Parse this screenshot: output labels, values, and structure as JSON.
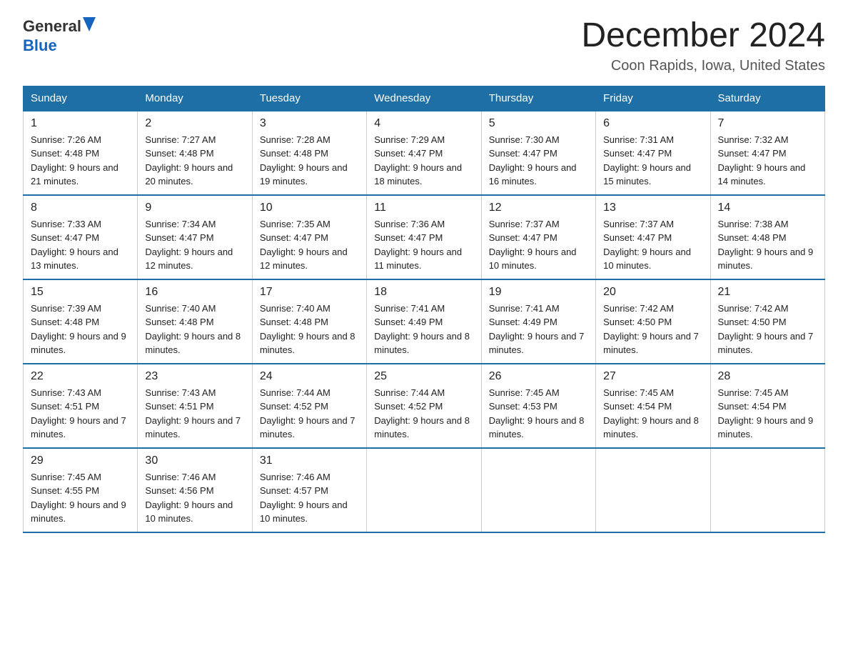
{
  "header": {
    "logo_general": "General",
    "logo_blue": "Blue",
    "main_title": "December 2024",
    "subtitle": "Coon Rapids, Iowa, United States"
  },
  "days_of_week": [
    "Sunday",
    "Monday",
    "Tuesday",
    "Wednesday",
    "Thursday",
    "Friday",
    "Saturday"
  ],
  "weeks": [
    [
      {
        "day": "1",
        "sunrise": "7:26 AM",
        "sunset": "4:48 PM",
        "daylight": "9 hours and 21 minutes."
      },
      {
        "day": "2",
        "sunrise": "7:27 AM",
        "sunset": "4:48 PM",
        "daylight": "9 hours and 20 minutes."
      },
      {
        "day": "3",
        "sunrise": "7:28 AM",
        "sunset": "4:48 PM",
        "daylight": "9 hours and 19 minutes."
      },
      {
        "day": "4",
        "sunrise": "7:29 AM",
        "sunset": "4:47 PM",
        "daylight": "9 hours and 18 minutes."
      },
      {
        "day": "5",
        "sunrise": "7:30 AM",
        "sunset": "4:47 PM",
        "daylight": "9 hours and 16 minutes."
      },
      {
        "day": "6",
        "sunrise": "7:31 AM",
        "sunset": "4:47 PM",
        "daylight": "9 hours and 15 minutes."
      },
      {
        "day": "7",
        "sunrise": "7:32 AM",
        "sunset": "4:47 PM",
        "daylight": "9 hours and 14 minutes."
      }
    ],
    [
      {
        "day": "8",
        "sunrise": "7:33 AM",
        "sunset": "4:47 PM",
        "daylight": "9 hours and 13 minutes."
      },
      {
        "day": "9",
        "sunrise": "7:34 AM",
        "sunset": "4:47 PM",
        "daylight": "9 hours and 12 minutes."
      },
      {
        "day": "10",
        "sunrise": "7:35 AM",
        "sunset": "4:47 PM",
        "daylight": "9 hours and 12 minutes."
      },
      {
        "day": "11",
        "sunrise": "7:36 AM",
        "sunset": "4:47 PM",
        "daylight": "9 hours and 11 minutes."
      },
      {
        "day": "12",
        "sunrise": "7:37 AM",
        "sunset": "4:47 PM",
        "daylight": "9 hours and 10 minutes."
      },
      {
        "day": "13",
        "sunrise": "7:37 AM",
        "sunset": "4:47 PM",
        "daylight": "9 hours and 10 minutes."
      },
      {
        "day": "14",
        "sunrise": "7:38 AM",
        "sunset": "4:48 PM",
        "daylight": "9 hours and 9 minutes."
      }
    ],
    [
      {
        "day": "15",
        "sunrise": "7:39 AM",
        "sunset": "4:48 PM",
        "daylight": "9 hours and 9 minutes."
      },
      {
        "day": "16",
        "sunrise": "7:40 AM",
        "sunset": "4:48 PM",
        "daylight": "9 hours and 8 minutes."
      },
      {
        "day": "17",
        "sunrise": "7:40 AM",
        "sunset": "4:48 PM",
        "daylight": "9 hours and 8 minutes."
      },
      {
        "day": "18",
        "sunrise": "7:41 AM",
        "sunset": "4:49 PM",
        "daylight": "9 hours and 8 minutes."
      },
      {
        "day": "19",
        "sunrise": "7:41 AM",
        "sunset": "4:49 PM",
        "daylight": "9 hours and 7 minutes."
      },
      {
        "day": "20",
        "sunrise": "7:42 AM",
        "sunset": "4:50 PM",
        "daylight": "9 hours and 7 minutes."
      },
      {
        "day": "21",
        "sunrise": "7:42 AM",
        "sunset": "4:50 PM",
        "daylight": "9 hours and 7 minutes."
      }
    ],
    [
      {
        "day": "22",
        "sunrise": "7:43 AM",
        "sunset": "4:51 PM",
        "daylight": "9 hours and 7 minutes."
      },
      {
        "day": "23",
        "sunrise": "7:43 AM",
        "sunset": "4:51 PM",
        "daylight": "9 hours and 7 minutes."
      },
      {
        "day": "24",
        "sunrise": "7:44 AM",
        "sunset": "4:52 PM",
        "daylight": "9 hours and 7 minutes."
      },
      {
        "day": "25",
        "sunrise": "7:44 AM",
        "sunset": "4:52 PM",
        "daylight": "9 hours and 8 minutes."
      },
      {
        "day": "26",
        "sunrise": "7:45 AM",
        "sunset": "4:53 PM",
        "daylight": "9 hours and 8 minutes."
      },
      {
        "day": "27",
        "sunrise": "7:45 AM",
        "sunset": "4:54 PM",
        "daylight": "9 hours and 8 minutes."
      },
      {
        "day": "28",
        "sunrise": "7:45 AM",
        "sunset": "4:54 PM",
        "daylight": "9 hours and 9 minutes."
      }
    ],
    [
      {
        "day": "29",
        "sunrise": "7:45 AM",
        "sunset": "4:55 PM",
        "daylight": "9 hours and 9 minutes."
      },
      {
        "day": "30",
        "sunrise": "7:46 AM",
        "sunset": "4:56 PM",
        "daylight": "9 hours and 10 minutes."
      },
      {
        "day": "31",
        "sunrise": "7:46 AM",
        "sunset": "4:57 PM",
        "daylight": "9 hours and 10 minutes."
      },
      null,
      null,
      null,
      null
    ]
  ]
}
